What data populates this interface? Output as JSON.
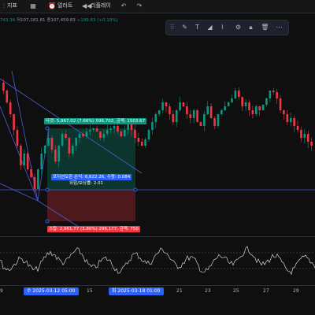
{
  "toolbar": {
    "indicators_label": "지표",
    "alerts_label": "얼러트",
    "replay_label": "리플레이"
  },
  "price_line": {
    "prefix": "743.34",
    "low": "저107,181.81",
    "close": "종107,459.83",
    "change": "+199.83 (+0.19%)"
  },
  "position": {
    "take_profit": "타겟: 5,967.02 (7.66%) 596,702, 금액: 1503.67",
    "entry_info": "포지션오픈 손익: 6,622.26, 수량: 0.084",
    "ratio": "위험/보상률: 2.01",
    "stop_loss": "스탑: 2,961.77 (3.80%) 296,177, 금액: 750"
  },
  "xaxis": {
    "ticks": [
      "9",
      "15",
      "21",
      "23",
      "25",
      "27",
      "29"
    ],
    "badge_left": "수 2025-03-12   05:00",
    "badge_right": "화 2025-03-18   01:00"
  },
  "colors": {
    "up": "#089981",
    "down": "#f23645",
    "trendline": "#4a5bd6",
    "accent": "#2962ff"
  },
  "icons": [
    "candles-icon",
    "indicators-icon",
    "grid-icon",
    "alert-icon",
    "replay-icon",
    "undo-icon",
    "redo-icon"
  ]
}
